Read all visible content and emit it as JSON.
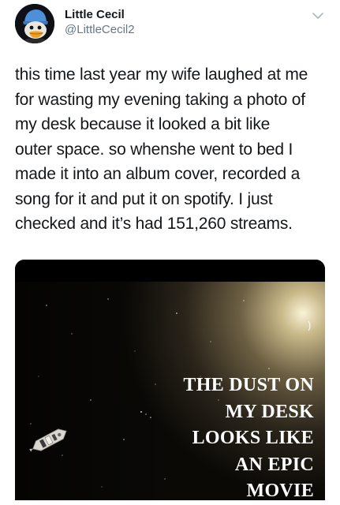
{
  "user": {
    "display_name": "Little Cecil",
    "handle": "@LittleCecil2",
    "avatar_icon": "penguin-avatar-icon"
  },
  "menu_icon": "chevron-down-icon",
  "tweet": {
    "lines": [
      "this time last year my wife laughed at me",
      "for wasting my evening taking a photo of",
      "my desk because it looked a bit like",
      "outer space. so whenshe went to bed I",
      "made it into an album cover, recorded a",
      "song for it and put it on spotify. I just",
      "checked and it’s had 151,260 streams."
    ]
  },
  "media": {
    "album_title_lines": [
      "THE DUST ON",
      "MY DESK",
      "LOOKS LIKE",
      "AN EPIC",
      "MOVIE"
    ],
    "spaceship_icon": "spaceship-icon"
  },
  "colors": {
    "text": "#14171a",
    "secondary": "#657786",
    "album_background": "#090805",
    "album_text": "#ffffff"
  }
}
